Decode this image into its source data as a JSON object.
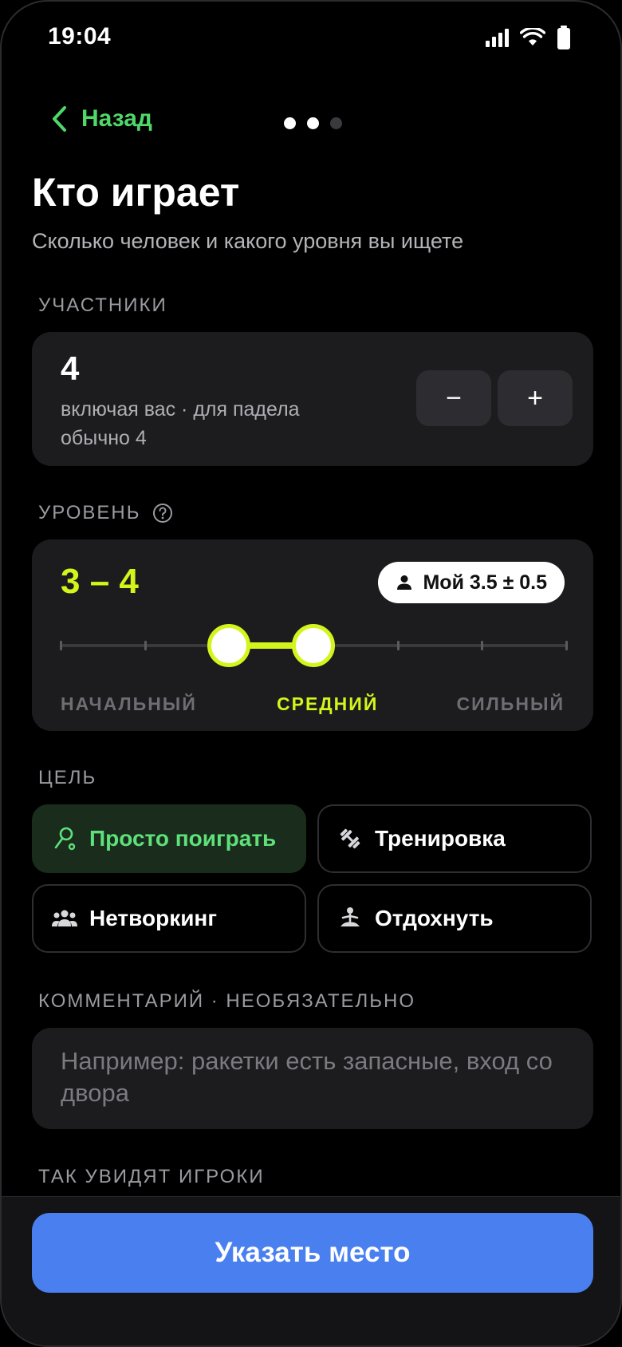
{
  "status": {
    "time": "19:04"
  },
  "nav": {
    "back_label": "Назад",
    "step": 2,
    "steps": 3
  },
  "header": {
    "title": "Кто играет",
    "subtitle": "Сколько человек и какого уровня вы ищете"
  },
  "participants": {
    "section_label": "УЧАСТНИКИ",
    "count": "4",
    "note": "включая вас · для падела обычно 4",
    "minus": "−",
    "plus": "+"
  },
  "level": {
    "section_label": "УРОВЕНЬ",
    "range_label": "3 – 4",
    "my_level": "Мой 3.5 ± 0.5",
    "min_selected": 3,
    "max_selected": 4,
    "scale_ticks": 7,
    "labels": [
      "НАЧАЛЬНЫЙ",
      "СРЕДНИЙ",
      "СИЛЬНЫЙ"
    ],
    "active_label": "СРЕДНИЙ",
    "accent": "#d4f51b"
  },
  "goal": {
    "section_label": "ЦЕЛЬ",
    "options": [
      {
        "label": "Просто поиграть",
        "icon": "person-play-icon",
        "selected": true
      },
      {
        "label": "Тренировка",
        "icon": "dumbbell-icon",
        "selected": false
      },
      {
        "label": "Нетворкинг",
        "icon": "people-group-icon",
        "selected": false
      },
      {
        "label": "Отдохнуть",
        "icon": "meditation-icon",
        "selected": false
      }
    ]
  },
  "comment": {
    "section_label": "КОММЕНТАРИЙ · НЕОБЯЗАТЕЛЬНО",
    "placeholder": "Например: ракетки есть запасные, вход со двора"
  },
  "preview": {
    "section_label": "ТАК УВИДЯТ ИГРОКИ"
  },
  "cta": {
    "label": "Указать место",
    "color": "#4a7ff0"
  }
}
